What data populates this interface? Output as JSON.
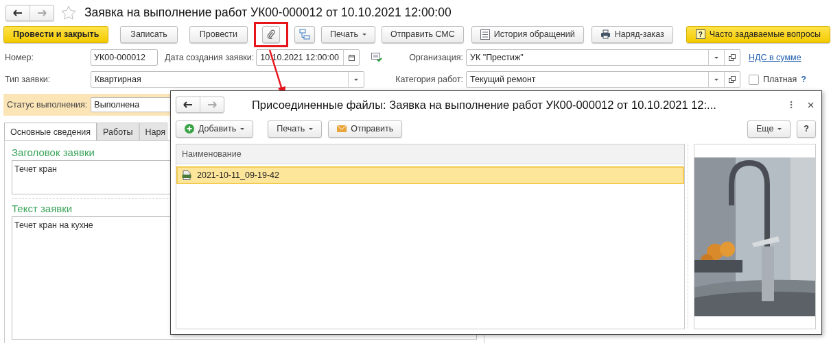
{
  "window": {
    "title": "Заявка на выполнение работ УК00-000012 от 10.10.2021 12:00:00"
  },
  "toolbar": [
    {
      "kind": "primary",
      "label": "Провести и закрыть"
    },
    {
      "kind": "plain",
      "label": "Записать"
    },
    {
      "kind": "plain",
      "label": "Провести"
    },
    {
      "kind": "attach",
      "highlighted": true
    },
    {
      "kind": "structure"
    },
    {
      "kind": "dropdown",
      "label": "Печать"
    },
    {
      "kind": "plain",
      "label": "Отправить СМС"
    },
    {
      "kind": "history",
      "label": "История обращений"
    },
    {
      "kind": "print",
      "label": "Наряд-заказ"
    },
    {
      "kind": "faq",
      "glyph": "?",
      "label": "Часто задаваемые вопросы"
    }
  ],
  "number": {
    "label": "Номер:",
    "value": "УК00-000012"
  },
  "created": {
    "label": "Дата создания заявки:",
    "value": "10.10.2021 12:00:00"
  },
  "organization": {
    "label": "Организация:",
    "value": "УК \"Престиж\""
  },
  "vat_link": "НДС в сумме",
  "type": {
    "label": "Тип заявки:",
    "value": "Квартирная"
  },
  "category": {
    "label": "Категория работ:",
    "value": "Текущий ремонт"
  },
  "paid": {
    "label": "Платная",
    "checked": false,
    "help": "?"
  },
  "status": {
    "label": "Статус выполнения:",
    "value": "Выполнена"
  },
  "tabs": [
    {
      "label": "Основные сведения",
      "selected": true
    },
    {
      "label": "Работы",
      "selected": false
    },
    {
      "label": "Наря",
      "selected": false
    }
  ],
  "sections": [
    {
      "title": "Заголовок заявки",
      "text": "Течет кран"
    },
    {
      "title": "Текст заявки",
      "text": "Течет кран на кухне"
    }
  ],
  "dialog": {
    "title": "Присоединенные файлы: Заявка на выполнение работ УК00-000012 от 10.10.2021 12:...",
    "toolbar": [
      {
        "kind": "add",
        "label": "Добавить"
      },
      {
        "kind": "dropdown",
        "label": "Печать"
      },
      {
        "kind": "send",
        "label": "Отправить"
      }
    ],
    "more_label": "Еще",
    "help_label": "?",
    "table": {
      "columns": [
        "Наименование"
      ],
      "rows": [
        {
          "name": "2021-10-11_09-19-42",
          "selected": true
        }
      ]
    }
  }
}
